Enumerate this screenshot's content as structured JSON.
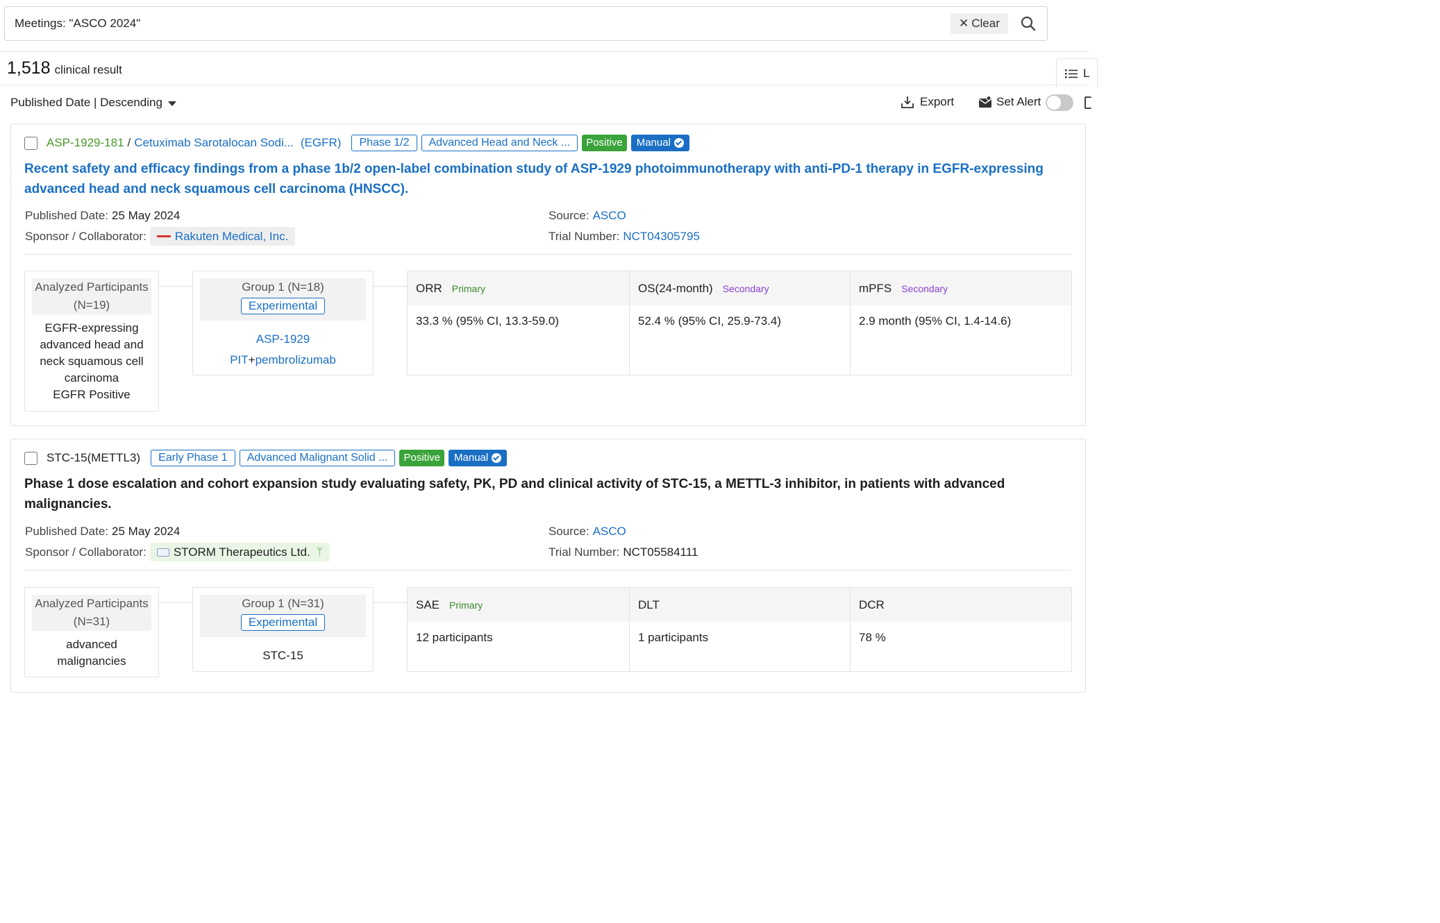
{
  "search": {
    "query": "Meetings: \"ASCO 2024\"",
    "clear_label": "Clear"
  },
  "results": {
    "count": "1,518",
    "label": "clinical result"
  },
  "view_toggle": {
    "label": "L"
  },
  "toolbar": {
    "sort_label": "Published Date | Descending",
    "export_label": "Export",
    "alert_label": "Set Alert",
    "alert_enabled": false
  },
  "colors": {
    "link_blue": "#1a6fc4",
    "positive_green": "#3aa339",
    "drug_green": "#4b9a2a",
    "secondary_purple": "#8a3fd1"
  },
  "labels": {
    "published": "Published Date:",
    "sponsor": "Sponsor / Collaborator:",
    "source": "Source:",
    "trial": "Trial Number:"
  },
  "cards": [
    {
      "drug_code": "ASP-1929-181",
      "drug_name": "Cetuximab Sarotalocan Sodi...",
      "target": "(EGFR)",
      "phase": "Phase 1/2",
      "indication": "Advanced Head and Neck ...",
      "result": "Positive",
      "manual": "Manual",
      "title": "Recent safety and efficacy findings from a phase 1b/2 open-label combination study of ASP-1929 photoimmunotherapy with anti-PD-1 therapy in EGFR-expressing advanced head and neck squamous cell carcinoma (HNSCC).",
      "published_date": "25 May 2024",
      "source": "ASCO",
      "sponsor": "Rakuten Medical, Inc.",
      "trial_number": "NCT04305795",
      "participants_header": "Analyzed Participants (N=19)",
      "participants_lines": [
        "EGFR-expressing",
        "advanced head and",
        "neck squamous cell",
        "carcinoma",
        "EGFR Positive"
      ],
      "group_name": "Group 1 (N=18)",
      "group_tag": "Experimental",
      "group_drug": "ASP-1929",
      "group_combo_a": "PIT",
      "group_combo_plus": "+",
      "group_combo_b": "pembrolizumab",
      "outcomes": [
        {
          "name": "ORR",
          "type": "Primary",
          "value": "33.3 % (95% CI, 13.3-59.0)"
        },
        {
          "name": "OS(24-month)",
          "type": "Secondary",
          "value": "52.4 % (95% CI, 25.9-73.4)"
        },
        {
          "name": "mPFS",
          "type": "Secondary",
          "value": "2.9 month (95% CI, 1.4-14.6)"
        }
      ]
    },
    {
      "drug_code": "STC-15(METTL3)",
      "phase": "Early Phase 1",
      "indication": "Advanced Malignant Solid ...",
      "result": "Positive",
      "manual": "Manual",
      "title": "Phase 1 dose escalation and cohort expansion study evaluating safety, PK, PD and clinical activity of STC-15, a METTL-3 inhibitor, in patients with advanced malignancies.",
      "published_date": "25 May 2024",
      "source": "ASCO",
      "sponsor": "STORM Therapeutics Ltd.",
      "trial_number": "NCT05584111",
      "participants_header": "Analyzed Participants (N=31)",
      "participants_lines": [
        "advanced",
        "malignancies"
      ],
      "group_name": "Group 1 (N=31)",
      "group_tag": "Experimental",
      "group_drug": "STC-15",
      "outcomes": [
        {
          "name": "SAE",
          "type": "Primary",
          "value": "12 participants"
        },
        {
          "name": "DLT",
          "type": "",
          "value": "1 participants"
        },
        {
          "name": "DCR",
          "type": "",
          "value": "78 %"
        }
      ]
    }
  ]
}
